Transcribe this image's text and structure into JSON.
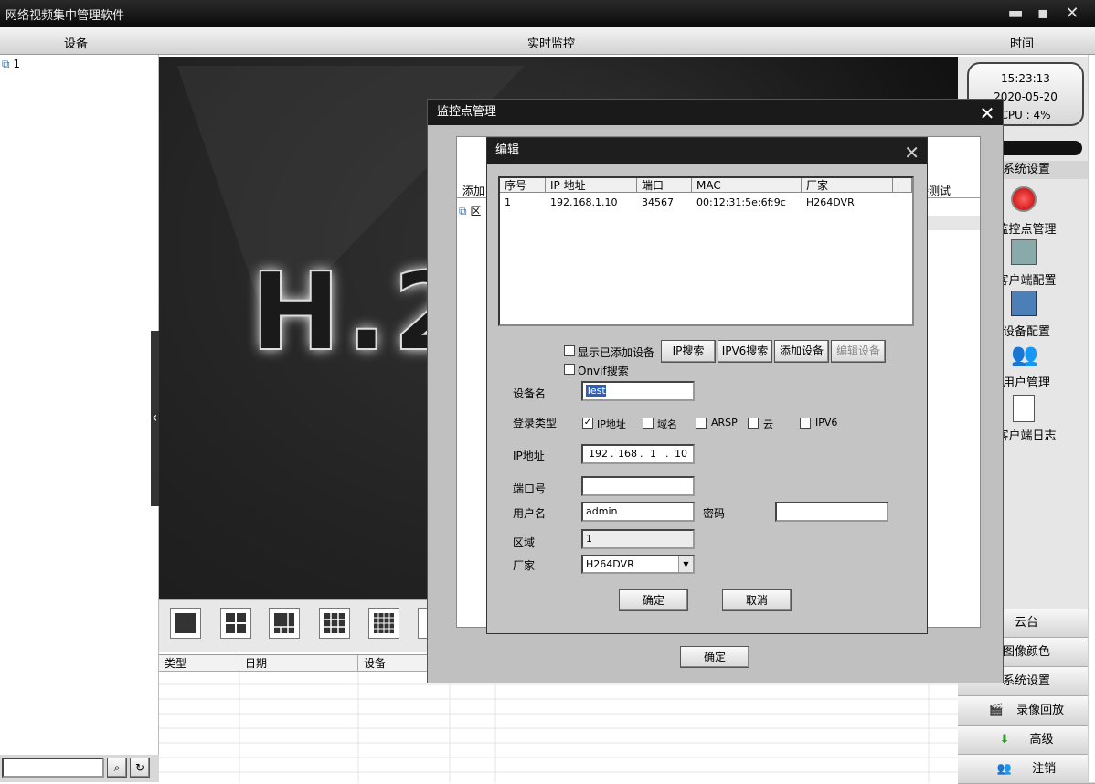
{
  "app": {
    "title": "网络视频集中管理软件"
  },
  "header": {
    "device_col": "设备",
    "live_col": "实时监控",
    "time_col": "时间"
  },
  "tree": {
    "root_label": "1"
  },
  "video": {
    "logo_text": "H.2"
  },
  "logs": {
    "columns": [
      "类型",
      "日期",
      "设备"
    ]
  },
  "clock": {
    "time": "15:23:13",
    "date": "2020-05-20",
    "cpu": "CPU : 4%"
  },
  "right_panel": {
    "section_title": "系统设置",
    "items": [
      "监控点管理",
      "客户端配置",
      "设备配置",
      "用户管理",
      "客户端日志"
    ],
    "bottom_buttons": [
      "云台",
      "图像颜色",
      "系统设置",
      "录像回放",
      "高级",
      "注销"
    ]
  },
  "dialog_main": {
    "title": "监控点管理",
    "tab_add": "添加",
    "tab_test": "连接测试",
    "tree_item": "区",
    "ok_label": "确定"
  },
  "dialog_edit": {
    "title": "编辑",
    "list_columns": [
      "序号",
      "IP 地址",
      "端口",
      "MAC",
      "厂家"
    ],
    "list_rows": [
      [
        "1",
        "192.168.1.10",
        "34567",
        "00:12:31:5e:6f:9c",
        "H264DVR"
      ]
    ],
    "show_added_label": "显示已添加设备",
    "onvif_label": "Onvif搜索",
    "btn_ip_search": "IP搜索",
    "btn_ipv6_search": "IPV6搜索",
    "btn_add_device": "添加设备",
    "btn_edit_device": "编辑设备",
    "device_name_label": "设备名",
    "device_name_value": "Test",
    "login_type_label": "登录类型",
    "login_types": [
      "IP地址",
      "域名",
      "ARSP",
      "云",
      "IPV6"
    ],
    "login_checked": "IP地址",
    "ip_label": "IP地址",
    "ip_octets": [
      "192",
      "168",
      "1",
      "10"
    ],
    "port_label": "端口号",
    "port_value": "",
    "user_label": "用户名",
    "user_value": "admin",
    "password_label": "密码",
    "password_value": "",
    "area_label": "区域",
    "area_value": "1",
    "vendor_label": "厂家",
    "vendor_value": "H264DVR",
    "ok_label": "确定",
    "cancel_label": "取消"
  }
}
